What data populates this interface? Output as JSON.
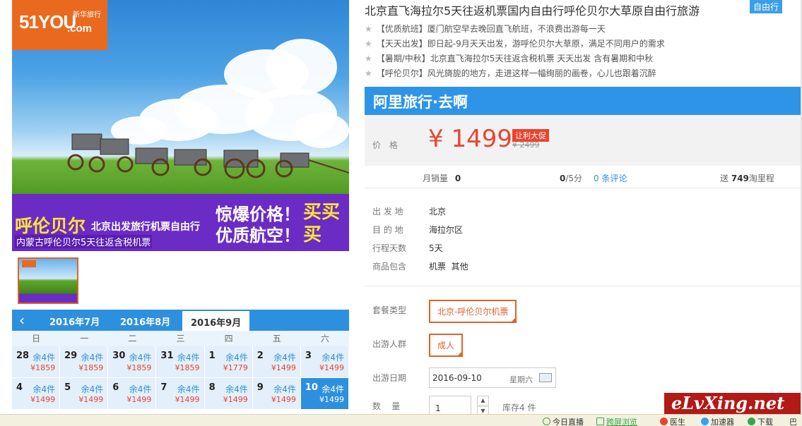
{
  "logo": {
    "main": "51YOU",
    "sub": "新华旅行",
    "domain": ".com"
  },
  "banner": {
    "destination": "呼伦贝尔",
    "tagline": "北京出发旅行机票自由行",
    "subline": "内蒙古呼伦贝尔5天往返含税机票",
    "promo_line1": "惊爆价格！",
    "promo_line2": "优质航空！",
    "calligraphy": "买买买"
  },
  "calendar": {
    "prev_icon": "chevron-left-icon",
    "months": [
      "2016年7月",
      "2016年8月",
      "2016年9月"
    ],
    "active_month": "2016年9月",
    "weekdays": [
      "日",
      "一",
      "二",
      "三",
      "四",
      "五",
      "六"
    ],
    "rows": [
      [
        {
          "day": "28",
          "stock": "余4件",
          "price": "¥1859"
        },
        {
          "day": "29",
          "stock": "余4件",
          "price": "¥1859"
        },
        {
          "day": "30",
          "stock": "余4件",
          "price": "¥1859"
        },
        {
          "day": "31",
          "stock": "余4件",
          "price": "¥1859"
        },
        {
          "day": "1",
          "stock": "余4件",
          "price": "¥1779"
        },
        {
          "day": "2",
          "stock": "余4件",
          "price": "¥1499"
        },
        {
          "day": "3",
          "stock": "余4件",
          "price": "¥1499"
        }
      ],
      [
        {
          "day": "4",
          "stock": "余4件",
          "price": "¥1499"
        },
        {
          "day": "5",
          "stock": "余4件",
          "price": "¥1499"
        },
        {
          "day": "6",
          "stock": "余4件",
          "price": "¥1499"
        },
        {
          "day": "7",
          "stock": "余4件",
          "price": "¥1499"
        },
        {
          "day": "8",
          "stock": "余4件",
          "price": "¥1499"
        },
        {
          "day": "9",
          "stock": "余4件",
          "price": "¥1499"
        },
        {
          "day": "10",
          "stock": "余4件",
          "price": "¥1499",
          "selected": true
        }
      ]
    ]
  },
  "product": {
    "title": "北京直飞海拉尔5天往返机票国内自由行呼伦贝尔大草原自由行旅游",
    "badge": "自由行",
    "features": [
      "【优质航班】厦门航空早去晚回直飞航班，不浪费出游每一天",
      "【天天出发】即日起-9月天天出发，游呼伦贝尔大草原，满足不同用户的需求",
      "【暑期/中秋】北京直飞海拉尔5天往返含税机票 天天出发 含有暑期和中秋",
      "【呼伦贝尔】风光旖旎的地方，走进这样一幅绚丽的画卷，心儿也跟着沉醉"
    ]
  },
  "brand": {
    "name": "阿里旅行·去啊"
  },
  "price": {
    "label": "价格",
    "current": "¥ 1499",
    "promo_tag": "让利大促",
    "original": "¥ 2499"
  },
  "stats": {
    "sales_label": "月销量",
    "sales_value": "0",
    "rating_value": "0",
    "rating_suffix": "/5分",
    "reviews": "0 条评论",
    "miles_prefix": "送",
    "miles_value": "749",
    "miles_suffix": "淘里程"
  },
  "details": [
    {
      "label": "出 发 地",
      "value": "北京"
    },
    {
      "label": "目 的 地",
      "value": "海拉尔区"
    },
    {
      "label": "行程天数",
      "value": "5天"
    },
    {
      "label": "商品包含",
      "value": "机票  其他"
    }
  ],
  "options": {
    "package_label": "套餐类型",
    "package_value": "北京-呼伦贝尔机票",
    "traveler_label": "出游人群",
    "traveler_value": "成人",
    "date_label": "出游日期",
    "date_value": "2016-09-10",
    "date_weekday": "星期六",
    "qty_label": "数    量",
    "qty_value": "1",
    "stock_text": "库存4 件"
  },
  "watermark": "eLvXing.net",
  "statusbar": {
    "items": [
      {
        "icon": "play-icon",
        "label": "今日直播",
        "color": "#3aa54a"
      },
      {
        "icon": "window-icon",
        "label": "跨屏浏览",
        "color": "#3aa54a"
      },
      {
        "icon": "plus-icon",
        "label": "医生",
        "color": "#e8452f"
      },
      {
        "icon": "rocket-icon",
        "label": "加速器",
        "color": "#3d9ee8"
      },
      {
        "icon": "download-icon",
        "label": "下载",
        "color": "#3aa54a"
      }
    ],
    "end_label": "巴"
  }
}
